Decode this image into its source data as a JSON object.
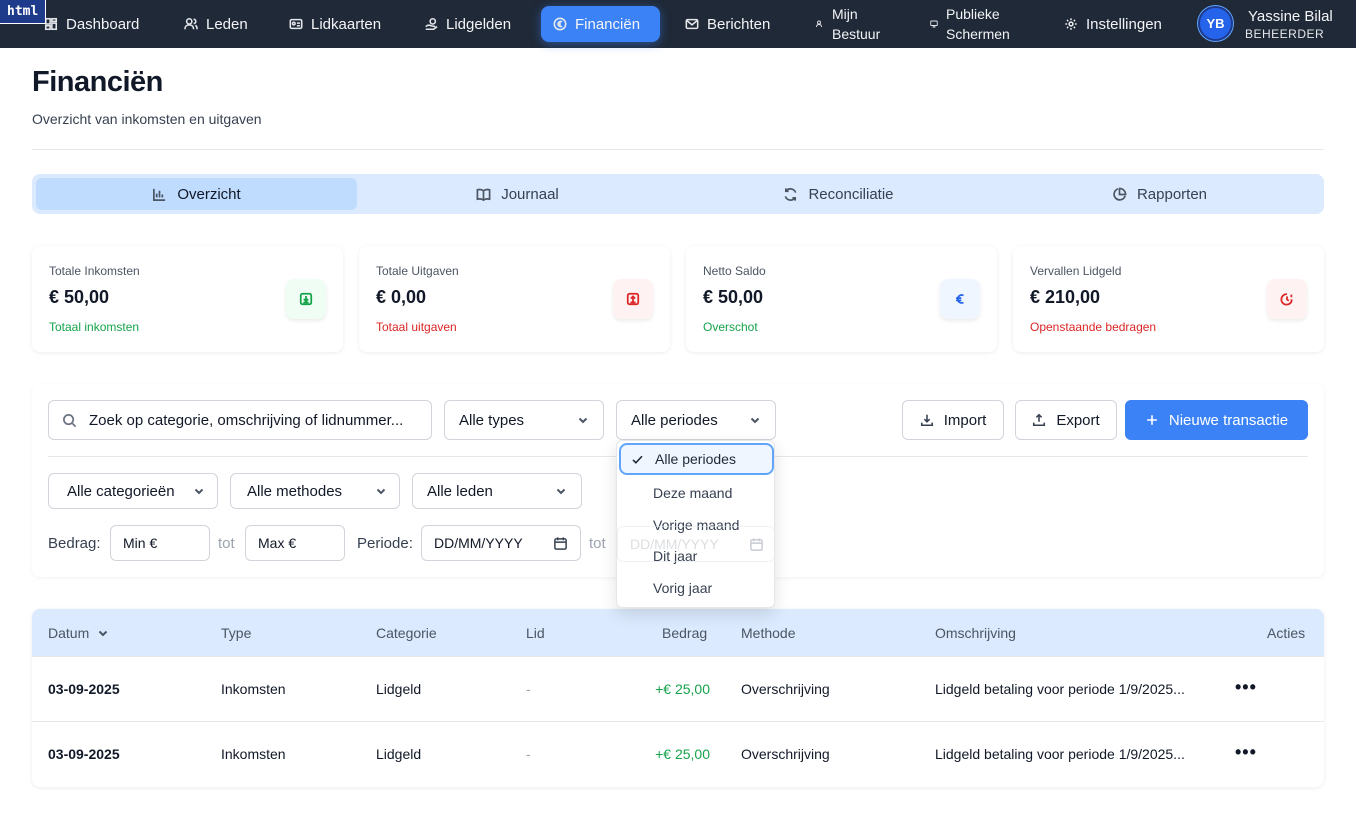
{
  "badge": "html",
  "nav": {
    "items": [
      {
        "label": "Dashboard",
        "icon": "dashboard-icon"
      },
      {
        "label": "Leden",
        "icon": "users-icon"
      },
      {
        "label": "Lidkaarten",
        "icon": "id-card-icon"
      },
      {
        "label": "Lidgelden",
        "icon": "coins-icon"
      },
      {
        "label": "Financiën",
        "icon": "euro-circle-icon",
        "active": true
      },
      {
        "label": "Berichten",
        "icon": "mail-icon"
      },
      {
        "label": "Mijn Bestuur",
        "icon": "users-small-icon"
      },
      {
        "label": "Publieke Schermen",
        "icon": "monitor-icon"
      },
      {
        "label": "Instellingen",
        "icon": "gear-icon"
      }
    ],
    "user": {
      "initials": "YB",
      "name": "Yassine Bilal",
      "role": "BEHEERDER"
    }
  },
  "header": {
    "title": "Financiën",
    "subtitle": "Overzicht van inkomsten en uitgaven"
  },
  "tabs": [
    {
      "label": "Overzicht",
      "icon": "bar-chart-icon",
      "active": true
    },
    {
      "label": "Journaal",
      "icon": "book-icon"
    },
    {
      "label": "Reconciliatie",
      "icon": "refresh-icon"
    },
    {
      "label": "Rapporten",
      "icon": "pie-chart-icon"
    }
  ],
  "stats": [
    {
      "label": "Totale Inkomsten",
      "value": "€ 50,00",
      "foot": "Totaal inkomsten",
      "foot_color": "#16a34a",
      "icon": "download-icon",
      "icon_bg": "#f0fdf4",
      "icon_color": "#16a34a"
    },
    {
      "label": "Totale Uitgaven",
      "value": "€ 0,00",
      "foot": "Totaal uitgaven",
      "foot_color": "#dc2626",
      "icon": "upload-icon",
      "icon_bg": "#fef2f2",
      "icon_color": "#dc2626"
    },
    {
      "label": "Netto Saldo",
      "value": "€ 50,00",
      "foot": "Overschot",
      "foot_color": "#16a34a",
      "icon": "euro-icon",
      "icon_bg": "#eff6ff",
      "icon_color": "#2563eb"
    },
    {
      "label": "Vervallen Lidgeld",
      "value": "€ 210,00",
      "foot": "Openstaande bedragen",
      "foot_color": "#dc2626",
      "icon": "clock-alert-icon",
      "icon_bg": "#fef2f2",
      "icon_color": "#dc2626"
    }
  ],
  "filters": {
    "search_placeholder": "Zoek op categorie, omschrijving of lidnummer...",
    "type_select": "Alle types",
    "period_select": "Alle periodes",
    "import_label": "Import",
    "export_label": "Export",
    "new_label": "Nieuwe transactie",
    "category_select": "Alle categorieën",
    "method_select": "Alle methodes",
    "member_select": "Alle leden",
    "amount_label": "Bedrag:",
    "min_placeholder": "Min €",
    "to_label": "tot",
    "max_placeholder": "Max €",
    "period_label": "Periode:",
    "date_placeholder": "DD/MM/YYYY"
  },
  "period_dropdown": {
    "options": [
      "Alle periodes",
      "Deze maand",
      "Vorige maand",
      "Dit jaar",
      "Vorig jaar"
    ],
    "selected": "Alle periodes"
  },
  "table": {
    "columns": [
      "Datum",
      "Type",
      "Categorie",
      "Lid",
      "Bedrag",
      "Methode",
      "Omschrijving",
      "Acties"
    ],
    "rows": [
      {
        "date": "03-09-2025",
        "type": "Inkomsten",
        "category": "Lidgeld",
        "member": "-",
        "amount": "+€ 25,00",
        "method": "Overschrijving",
        "description": "Lidgeld betaling voor periode 1/9/2025..."
      },
      {
        "date": "03-09-2025",
        "type": "Inkomsten",
        "category": "Lidgeld",
        "member": "-",
        "amount": "+€ 25,00",
        "method": "Overschrijving",
        "description": "Lidgeld betaling voor periode 1/9/2025..."
      }
    ],
    "actions_glyph": "•••"
  }
}
